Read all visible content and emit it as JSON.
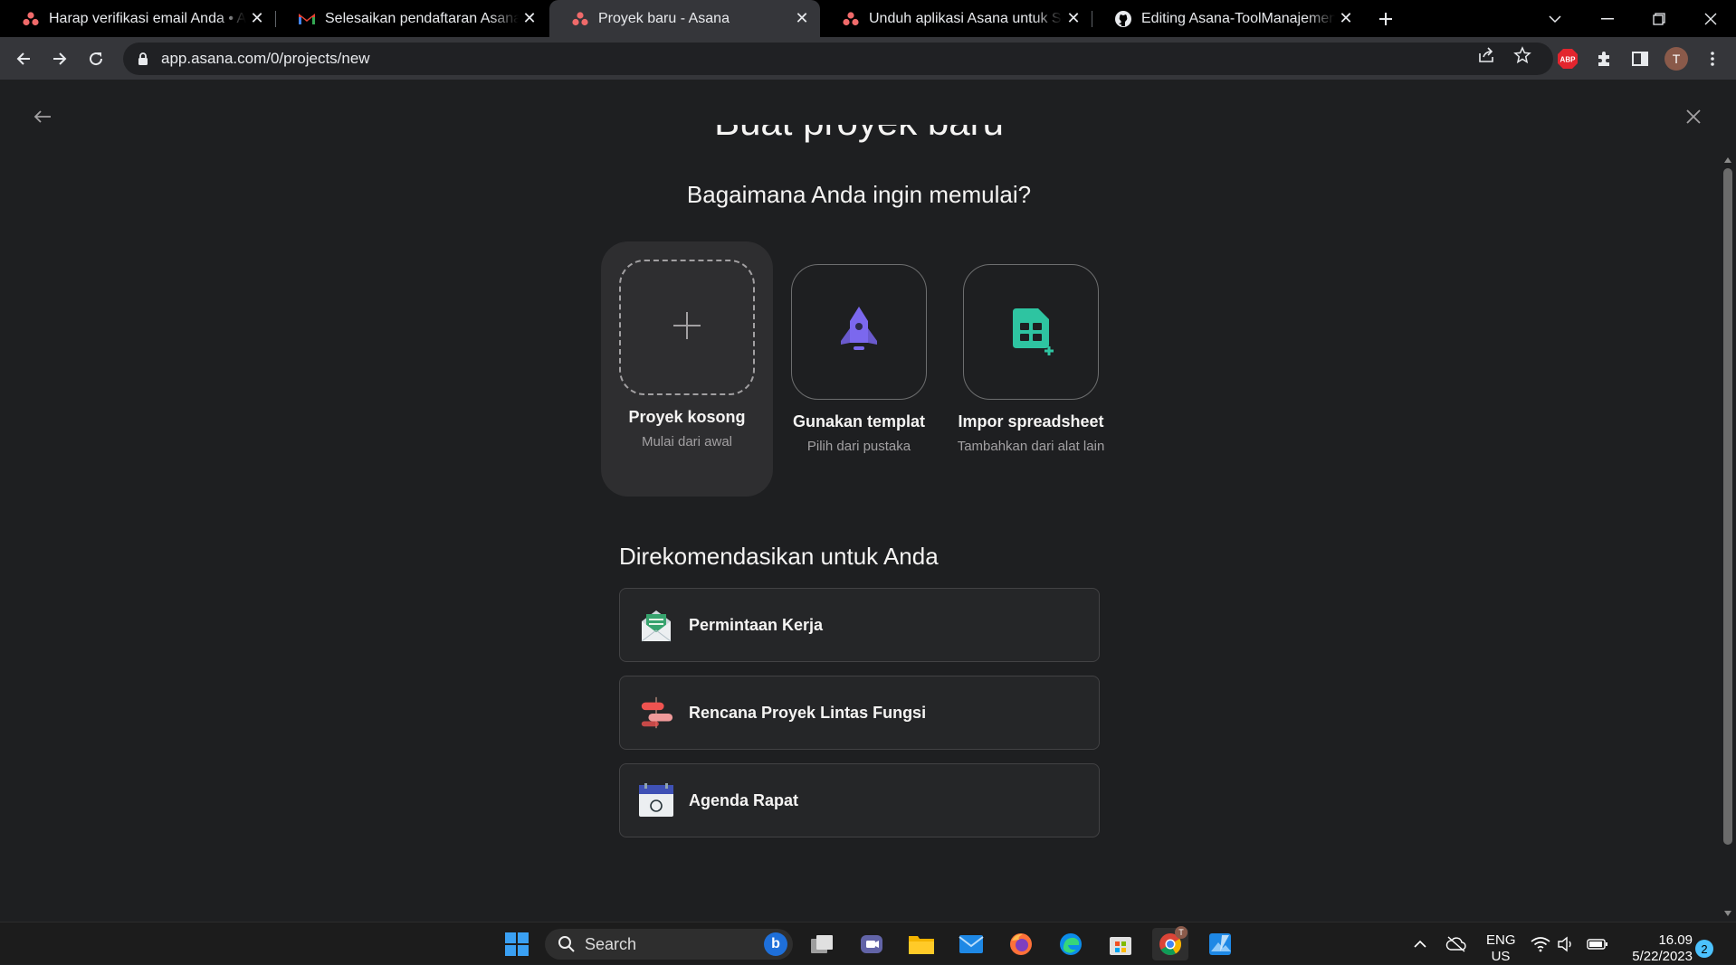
{
  "browser": {
    "tabs": [
      {
        "title": "Harap verifikasi email Anda • Asana",
        "favicon": "asana-icon",
        "active": false
      },
      {
        "title": "Selesaikan pendaftaran Asana Anda",
        "favicon": "gmail-icon",
        "active": false
      },
      {
        "title": "Proyek baru - Asana",
        "favicon": "asana-icon",
        "active": true
      },
      {
        "title": "Unduh aplikasi Asana untuk Seluler",
        "favicon": "asana-icon",
        "active": false
      },
      {
        "title": "Editing Asana-ToolManajemenProyek",
        "favicon": "github-icon",
        "active": false
      }
    ],
    "url": "app.asana.com/0/projects/new",
    "profile_initial": "T",
    "extension_badge": "ABP"
  },
  "page": {
    "title": "Buat proyek baru",
    "subtitle": "Bagaimana Anda ingin memulai?",
    "options": [
      {
        "label": "Proyek kosong",
        "desc": "Mulai dari awal",
        "icon": "plus-icon",
        "selected": true
      },
      {
        "label": "Gunakan templat",
        "desc": "Pilih dari pustaka",
        "icon": "rocket-icon",
        "selected": false
      },
      {
        "label": "Impor spreadsheet",
        "desc": "Tambahkan dari alat lain",
        "icon": "spreadsheet-icon",
        "selected": false
      }
    ],
    "recommended_heading": "Direkomendasikan untuk Anda",
    "recommended": [
      {
        "label": "Permintaan Kerja",
        "icon": "envelope-icon"
      },
      {
        "label": "Rencana Proyek Lintas Fungsi",
        "icon": "signpost-icon"
      },
      {
        "label": "Agenda Rapat",
        "icon": "calendar-icon"
      }
    ]
  },
  "taskbar": {
    "search_label": "Search",
    "language": "ENG",
    "region": "US",
    "time": "16.09",
    "date": "5/22/2023",
    "notification_count": "2",
    "chrome_badge": "T"
  },
  "colors": {
    "asana_coral": "#f06a6a",
    "rocket_purple": "#7b68ee",
    "spreadsheet_green": "#2ec4a1",
    "page_bg": "#1e1f21"
  }
}
